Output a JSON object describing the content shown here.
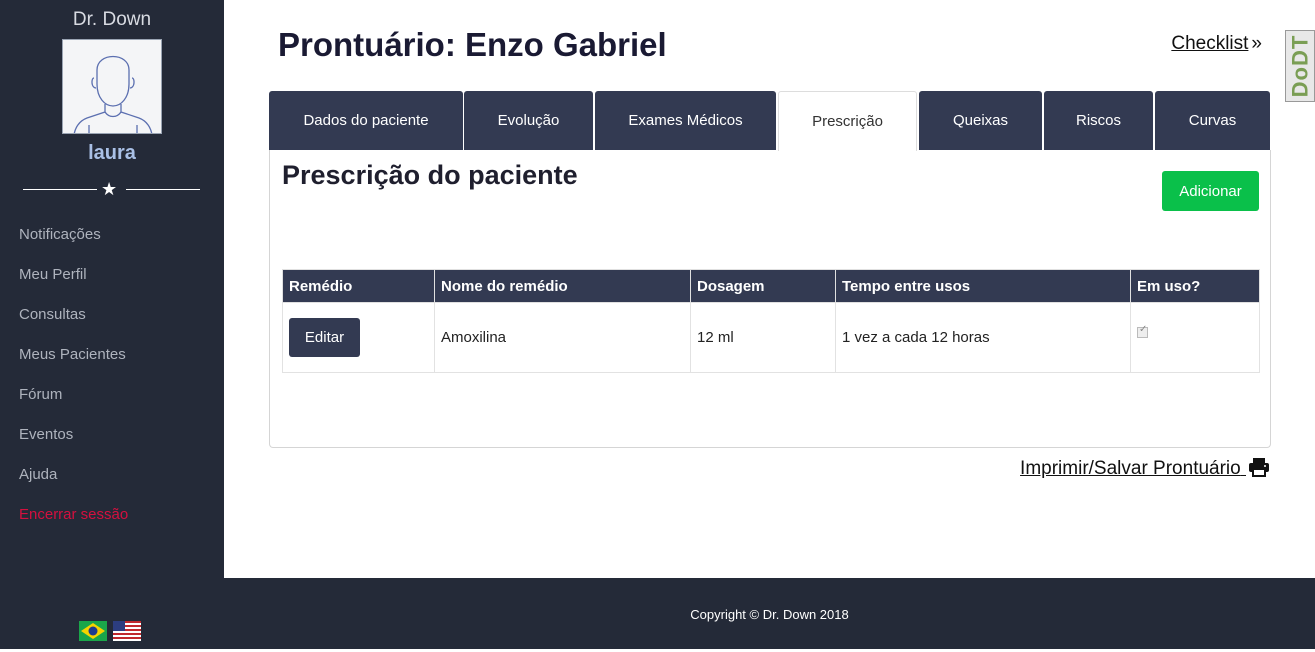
{
  "sidebar": {
    "brand": "Dr. Down",
    "username": "laura",
    "items": [
      {
        "label": "Notificações"
      },
      {
        "label": "Meu Perfil"
      },
      {
        "label": "Consultas"
      },
      {
        "label": "Meus Pacientes"
      },
      {
        "label": "Fórum"
      },
      {
        "label": "Eventos"
      },
      {
        "label": "Ajuda"
      },
      {
        "label": "Encerrar sessão"
      }
    ],
    "flags": [
      "brazil-flag",
      "usa-flag"
    ]
  },
  "header": {
    "title": "Prontuário: Enzo Gabriel",
    "checklist_label": "Checklist",
    "badge": "DoDT"
  },
  "tabs": [
    {
      "label": "Dados do paciente"
    },
    {
      "label": "Evolução"
    },
    {
      "label": "Exames Médicos"
    },
    {
      "label": "Prescrição",
      "active": true
    },
    {
      "label": "Queixas"
    },
    {
      "label": "Riscos"
    },
    {
      "label": "Curvas"
    }
  ],
  "panel": {
    "title": "Prescrição do paciente",
    "add_label": "Adicionar",
    "table": {
      "headers": [
        "Remédio",
        "Nome do remédio",
        "Dosagem",
        "Tempo entre usos",
        "Em uso?"
      ],
      "rows": [
        {
          "action": "Editar",
          "name": "Amoxilina",
          "dosage": "12 ml",
          "interval": "1 vez a cada 12 horas",
          "in_use": true
        }
      ]
    }
  },
  "print_label": "Imprimir/Salvar Prontuário",
  "footer": "Copyright © Dr. Down 2018",
  "colors": {
    "sidebar": "#242a38",
    "tab": "#333a52",
    "add": "#0ac04a",
    "logout": "#d4103f"
  }
}
